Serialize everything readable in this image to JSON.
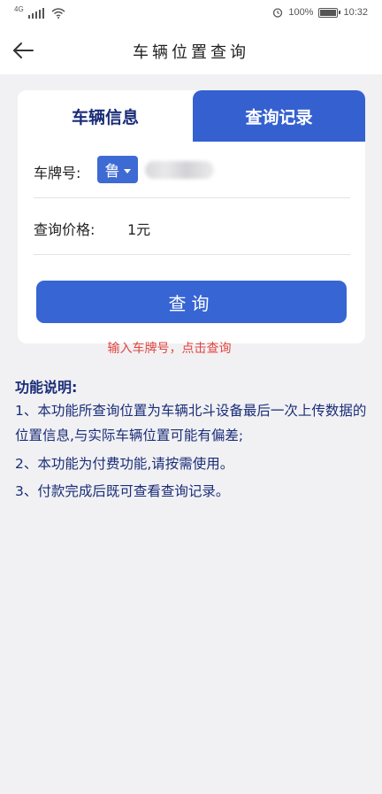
{
  "status_bar": {
    "network": "4G",
    "battery": "100%",
    "battery_level": 1.0,
    "time": "10:32"
  },
  "nav": {
    "title": "车辆位置查询"
  },
  "tabs": {
    "active_label": "车辆信息",
    "inactive_label": "查询记录"
  },
  "form": {
    "plate_label": "车牌号:",
    "province_value": "鲁",
    "plate_value": "",
    "price_label": "查询价格:",
    "price_value": "1元",
    "submit_label": "查询"
  },
  "hint": "输入车牌号，点击查询",
  "description": {
    "title": "功能说明:",
    "items": [
      "1、本功能所查询位置为车辆北斗设备最后一次上传数据的位置信息,与实际车辆位置可能有偏差;",
      "2、本功能为付费功能,请按需使用。",
      "3、付款完成后既可查看查询记录。"
    ]
  },
  "colors": {
    "primary": "#3765d4",
    "text_dark_blue": "#1a2d78",
    "hint_red": "#e24440",
    "background": "#f1f1f3"
  }
}
